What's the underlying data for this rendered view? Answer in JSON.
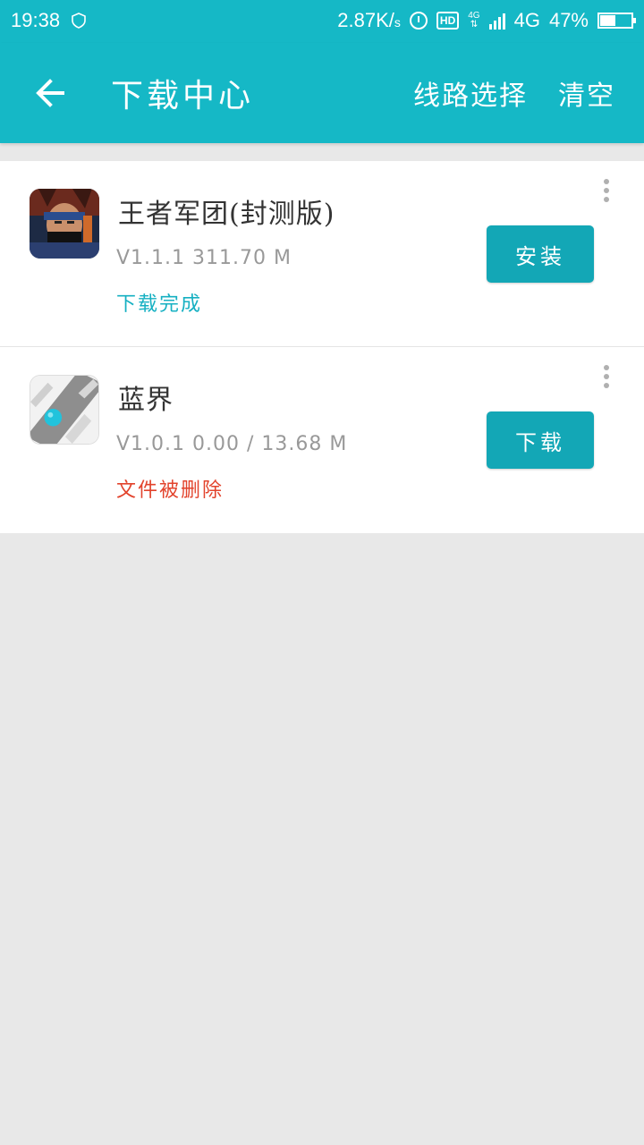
{
  "status_bar": {
    "time": "19:38",
    "speed": "2.87K/",
    "speed_unit": "s",
    "hd": "HD",
    "sig_top": "4G",
    "network": "4G",
    "battery": "47%"
  },
  "app_bar": {
    "title": "下载中心",
    "route_select": "线路选择",
    "clear": "清空"
  },
  "colors": {
    "primary": "#15b8c6",
    "button": "#13a7b6",
    "done_status": "#16b0c2",
    "deleted_status": "#e2432c"
  },
  "downloads": [
    {
      "name": "王者军团(封测版)",
      "meta": "V1.1.1 311.70 M",
      "status": "下载完成",
      "action": "安装",
      "icon": "ninja-game-icon"
    },
    {
      "name": "蓝界",
      "meta": "V1.0.1 0.00 / 13.68 M",
      "status": "文件被删除",
      "action": "下载",
      "icon": "blue-ball-game-icon"
    }
  ]
}
